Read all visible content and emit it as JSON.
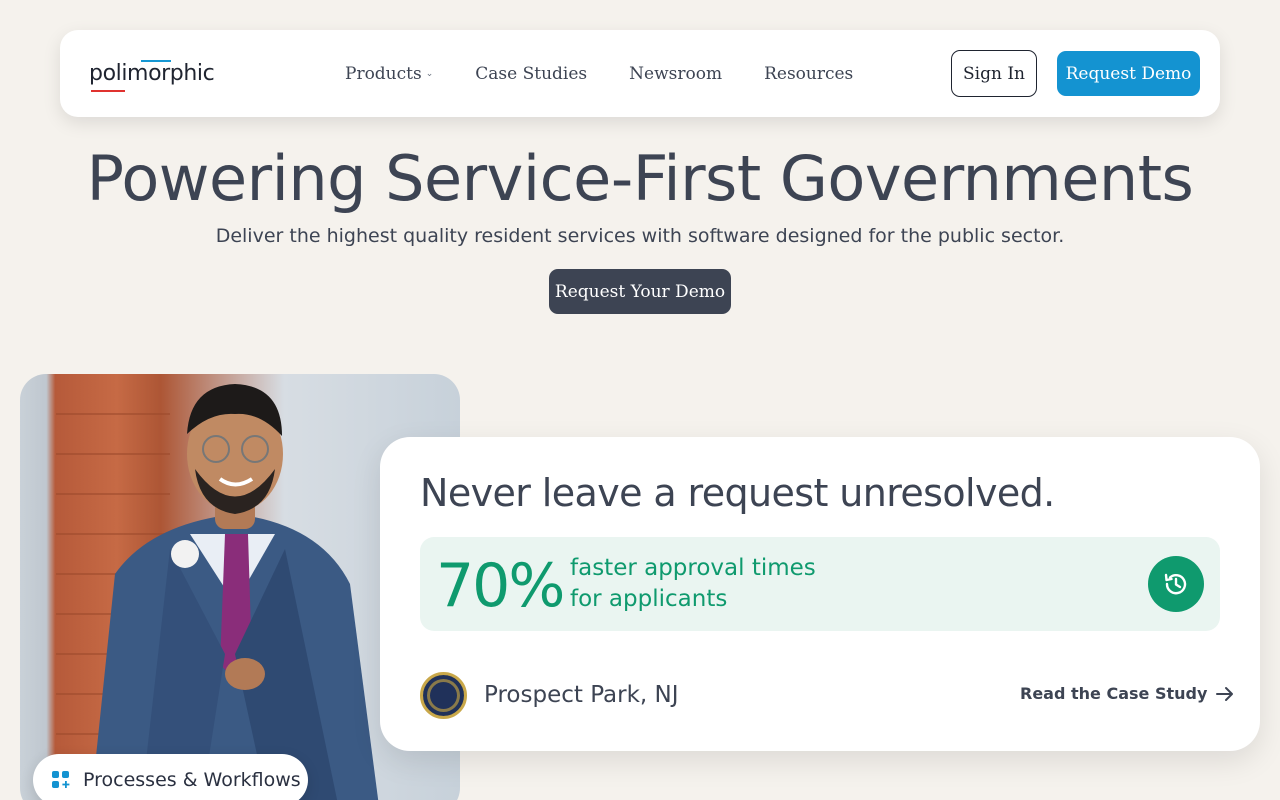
{
  "nav": {
    "logo": "polimorphic",
    "links": [
      {
        "label": "Products",
        "has_dropdown": true
      },
      {
        "label": "Case Studies"
      },
      {
        "label": "Newsroom"
      },
      {
        "label": "Resources"
      }
    ],
    "sign_in": "Sign In",
    "request_demo": "Request Demo"
  },
  "hero": {
    "title": "Powering Service-First Governments",
    "subtitle": "Deliver the highest quality resident services with software designed for the public sector.",
    "cta": "Request Your Demo"
  },
  "card": {
    "title": "Never leave a request unresolved.",
    "stat_value": "70%",
    "stat_line1": "faster approval times",
    "stat_line2": "for applicants",
    "location": "Prospect Park, NJ",
    "case_link": "Read the Case Study"
  },
  "pill": {
    "label": "Processes & Workflows"
  },
  "colors": {
    "accent_blue": "#1493d1",
    "dark": "#3d4453",
    "green": "#0f9a6e",
    "background": "#f5f2ed"
  },
  "icons": [
    "chevron-down-icon",
    "history-icon",
    "arrow-right-icon",
    "apps-add-icon",
    "city-seal"
  ]
}
